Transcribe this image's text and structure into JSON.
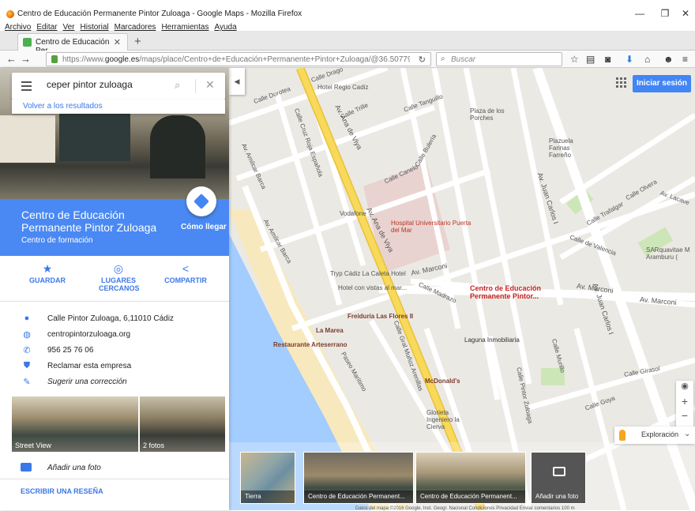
{
  "window": {
    "title": "Centro de Educación Permanente Pintor Zuloaga - Google Maps - Mozilla Firefox",
    "controls": [
      "—",
      "❐",
      "✕"
    ]
  },
  "menu": [
    "Archivo",
    "Editar",
    "Ver",
    "Historial",
    "Marcadores",
    "Herramientas",
    "Ayuda"
  ],
  "tab": {
    "label": "Centro de Educación Per...",
    "close": "✕",
    "new": "+"
  },
  "nav": {
    "url_prefix": "https://www.",
    "url_domain": "google.es",
    "url_rest": "/maps/place/Centro+de+Educación+Permanente+Pintor+Zuloaga/@36.50779!",
    "search_placeholder": "Buscar"
  },
  "search": {
    "query": "ceper pintor zuloaga",
    "back": "Volver a los resultados"
  },
  "place": {
    "name": "Centro de Educación Permanente Pintor Zuloaga",
    "type": "Centro de formación",
    "directions": "Cómo llegar"
  },
  "actions": [
    {
      "icon": "★",
      "label": "GUARDAR"
    },
    {
      "icon": "◎",
      "label": "LUGARES CERCANOS"
    },
    {
      "icon": "<",
      "label": "COMPARTIR"
    }
  ],
  "info": [
    {
      "icon": "location-icon",
      "text": "Calle Pintor Zuloaga, 6,11010 Cádiz"
    },
    {
      "icon": "globe-icon",
      "text": "centropintorzuloaga.org"
    },
    {
      "icon": "phone-icon",
      "text": "956 25 76 06"
    },
    {
      "icon": "shield-check-icon",
      "text": "Reclamar esta empresa"
    },
    {
      "icon": "pencil-icon",
      "text": "Sugerir una corrección"
    }
  ],
  "photos": {
    "street_view": "Street View",
    "count": "2 fotos"
  },
  "add_photo": "Añadir una foto",
  "write_review": "ESCRIBIR UNA RESEÑA",
  "map": {
    "signin": "Iniciar sesión",
    "explore": "Exploración",
    "pin_label": "Centro de Educación Permanente Pintor...",
    "labels": {
      "hotel_regio": "Hotel Regio Cadiz",
      "plaza_porches": "Plaza de los Porches",
      "plazuela": "Plazuela Farinas Farreño",
      "hospital": "Hospital Universitario Puerta del Mar",
      "vodafone": "Vodafone",
      "tryp": "Tryp Cádiz La Caleta Hotel",
      "tryp_sub": "Hotel con vistas al mar...",
      "freiduria": "Freiduría Las Flores II",
      "lamarea": "La Marea",
      "arteserrano": "Restaurante Arteserrano",
      "laguna": "Laguna Inmobiliaria",
      "mcdonalds": "McDonald's",
      "glorieta": "Glorieta Ingeniero la Cierva",
      "sarq": "SARquavitae M Aramburu (",
      "av_ana": "Av. Ana de Viya",
      "av_marconi": "Av. Marconi",
      "av_amilcar": "Av. Amílcar Barca",
      "calle_girasol": "Calle Girasol",
      "calle_goya": "Calle Goya",
      "calle_dorotea": "Calle Dorotea",
      "calle_canelo": "Calle Canelo",
      "calle_trille": "Calle Trille",
      "calle_tanguillo": "Calle Tanguillo",
      "calle_bulerias": "Calle Bulería",
      "av_juan_carlos": "Av. Juan Carlos I",
      "calle_olvera": "Calle Olvera",
      "calle_trafalgar": "Calle Trafalgar",
      "calle_valencia": "Calle de Valencia",
      "calle_lacave": "Av. Lacave",
      "calle_drago": "Calle Drago",
      "calle_murillo": "Calle Murillo",
      "calle_pintor_zuloaga": "Calle Pintor Zuloaga",
      "calle_madrazo": "Calle Madrazo",
      "calle_gral_munoz": "Calle Gral Muñoz Arenillas",
      "paseo_maritimo": "Paseo Marítimo",
      "calle_cruz_roja": "Calle Cruz Roja Española"
    }
  },
  "strip": [
    {
      "caption": "Tierra"
    },
    {
      "caption": "Centro de Educación Permanent..."
    },
    {
      "caption": "Centro de Educación Permanent..."
    },
    {
      "caption": "Añadir una foto"
    }
  ],
  "footer": "Datos del mapa ©2016 Google, Inst. Geogr. Nacional    Condiciones    Privacidad    Enviar comentarios    100 m",
  "colors": {
    "accent": "#4285f4",
    "band": "#4a89f3",
    "road_main": "#f5d14a",
    "sea": "#a3ccff",
    "beach": "#f5e6b8"
  }
}
